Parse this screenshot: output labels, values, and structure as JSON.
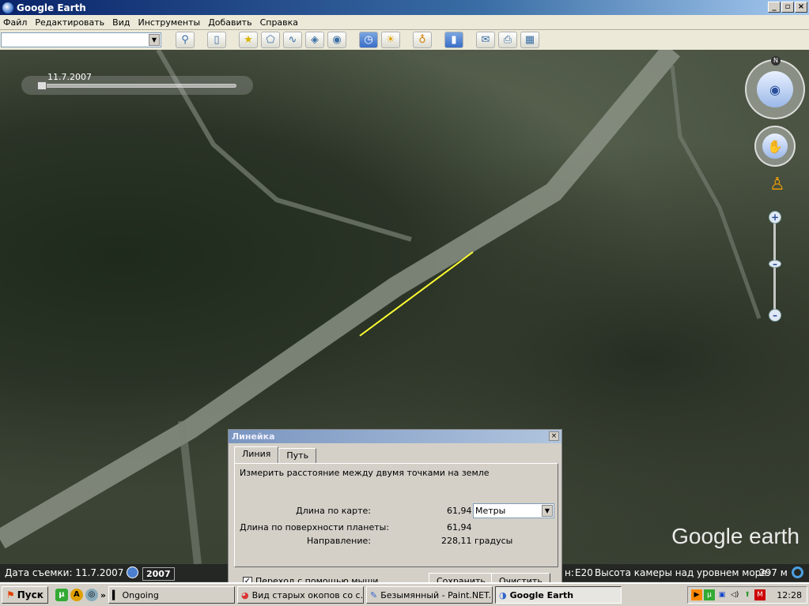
{
  "window": {
    "title": "Google Earth",
    "buttons": [
      "_",
      "▫",
      "×"
    ]
  },
  "menu": [
    "Файл",
    "Редактировать",
    "Вид",
    "Инструменты",
    "Добавить",
    "Справка"
  ],
  "search": {
    "value": ""
  },
  "toolbar": [
    "sidebar-icon",
    "placemark-icon",
    "polygon-icon",
    "path-icon",
    "overlay-icon",
    "tour-icon",
    "historical-imagery-icon",
    "sunlight-icon",
    "planet-icon",
    "ruler-icon",
    "email-icon",
    "print-icon",
    "maps-icon"
  ],
  "map": {
    "time_slider_label": "11.7.2007",
    "logo": "Google earth",
    "north": "N"
  },
  "status": {
    "date_label": "Дата съемки: 11.7.2007",
    "year": "2007",
    "coord_fragment": "н:",
    "coord": "E20",
    "altitude_label": "Высота камеры над уровнем моря:",
    "altitude": "297 м"
  },
  "ruler": {
    "title": "Линейка",
    "close": "×",
    "tabs": [
      "Линия",
      "Путь"
    ],
    "description": "Измерить расстояние между двумя точками на земле",
    "map_length_label": "Длина по карте:",
    "map_length": "61,94",
    "units": "Метры",
    "ground_length_label": "Длина по поверхности планеты:",
    "ground_length": "61,94",
    "heading_label": "Направление:",
    "heading": "228,11 градусы",
    "mouse_nav": "Переход с помощью мыши",
    "save": "Сохранить",
    "clear": "Очистить"
  },
  "taskbar": {
    "start": "Пуск",
    "overflow": "»",
    "tasks": [
      "Ongoing",
      "Вид старых окопов со с...",
      "Безымянный - Paint.NET...",
      "Google Earth"
    ],
    "clock": "12:28"
  },
  "colors": {
    "measure_line": "#ffff33",
    "title": "#0a246a"
  }
}
